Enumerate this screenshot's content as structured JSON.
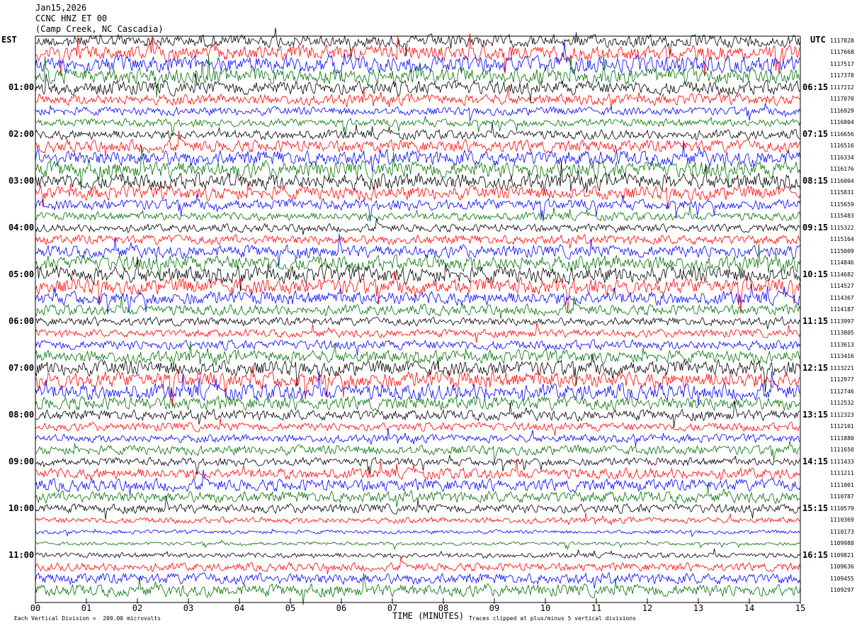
{
  "header": {
    "date": "Jan15,2026",
    "channel": "CCNC HNZ ET 00",
    "station": "(Camp Creek, NC Cascadia)"
  },
  "left_zone_label": "EST",
  "right_zone_label": "UTC",
  "footer": {
    "scale_note": "Each Vertical Division =  200.00 microvolts",
    "xlabel": "TIME (MINUTES)",
    "clip_note": "Traces clipped at plus/minus 5 vertical divisions"
  },
  "chart_data": {
    "type": "line",
    "title": "",
    "xlabel": "TIME (MINUTES)",
    "ylabel": "",
    "xlim": [
      0,
      15
    ],
    "x_ticks": [
      "00",
      "01",
      "02",
      "03",
      "04",
      "05",
      "06",
      "07",
      "08",
      "09",
      "10",
      "11",
      "12",
      "13",
      "14",
      "15"
    ],
    "trace_colors": [
      "#000000",
      "#ff0000",
      "#0000ff",
      "#007000"
    ],
    "traces_per_hour": 4,
    "minutes_per_trace": 15,
    "total_traces": 48,
    "left_time_labels": [
      "01:00",
      "02:00",
      "03:00",
      "04:00",
      "05:00",
      "06:00",
      "07:00",
      "08:00",
      "09:00",
      "10:00",
      "11:00"
    ],
    "right_time_labels": [
      "06:15",
      "07:15",
      "08:15",
      "09:15",
      "10:15",
      "11:15",
      "12:15",
      "13:15",
      "14:15",
      "15:15",
      "16:15"
    ],
    "right_trace_counts": [
      "1117828",
      "1117668",
      "1117517",
      "1117378",
      "1117212",
      "1117070",
      "1116929",
      "1116804",
      "1116656",
      "1116516",
      "1116334",
      "1116176",
      "1116004",
      "1115831",
      "1115659",
      "1115483",
      "1115322",
      "1115164",
      "1115009",
      "1114846",
      "1114682",
      "1114527",
      "1114367",
      "1114187",
      "1113997",
      "1113805",
      "1113613",
      "1113416",
      "1113221",
      "1112977",
      "1112746",
      "1112532",
      "1112323",
      "1112101",
      "1111880",
      "1111650",
      "1111433",
      "1111211",
      "1111001",
      "1110787",
      "1110579",
      "1110369",
      "1110173",
      "1109988",
      "1109821",
      "1109636",
      "1109455",
      "1109297"
    ],
    "grid": false,
    "legend": "none"
  }
}
